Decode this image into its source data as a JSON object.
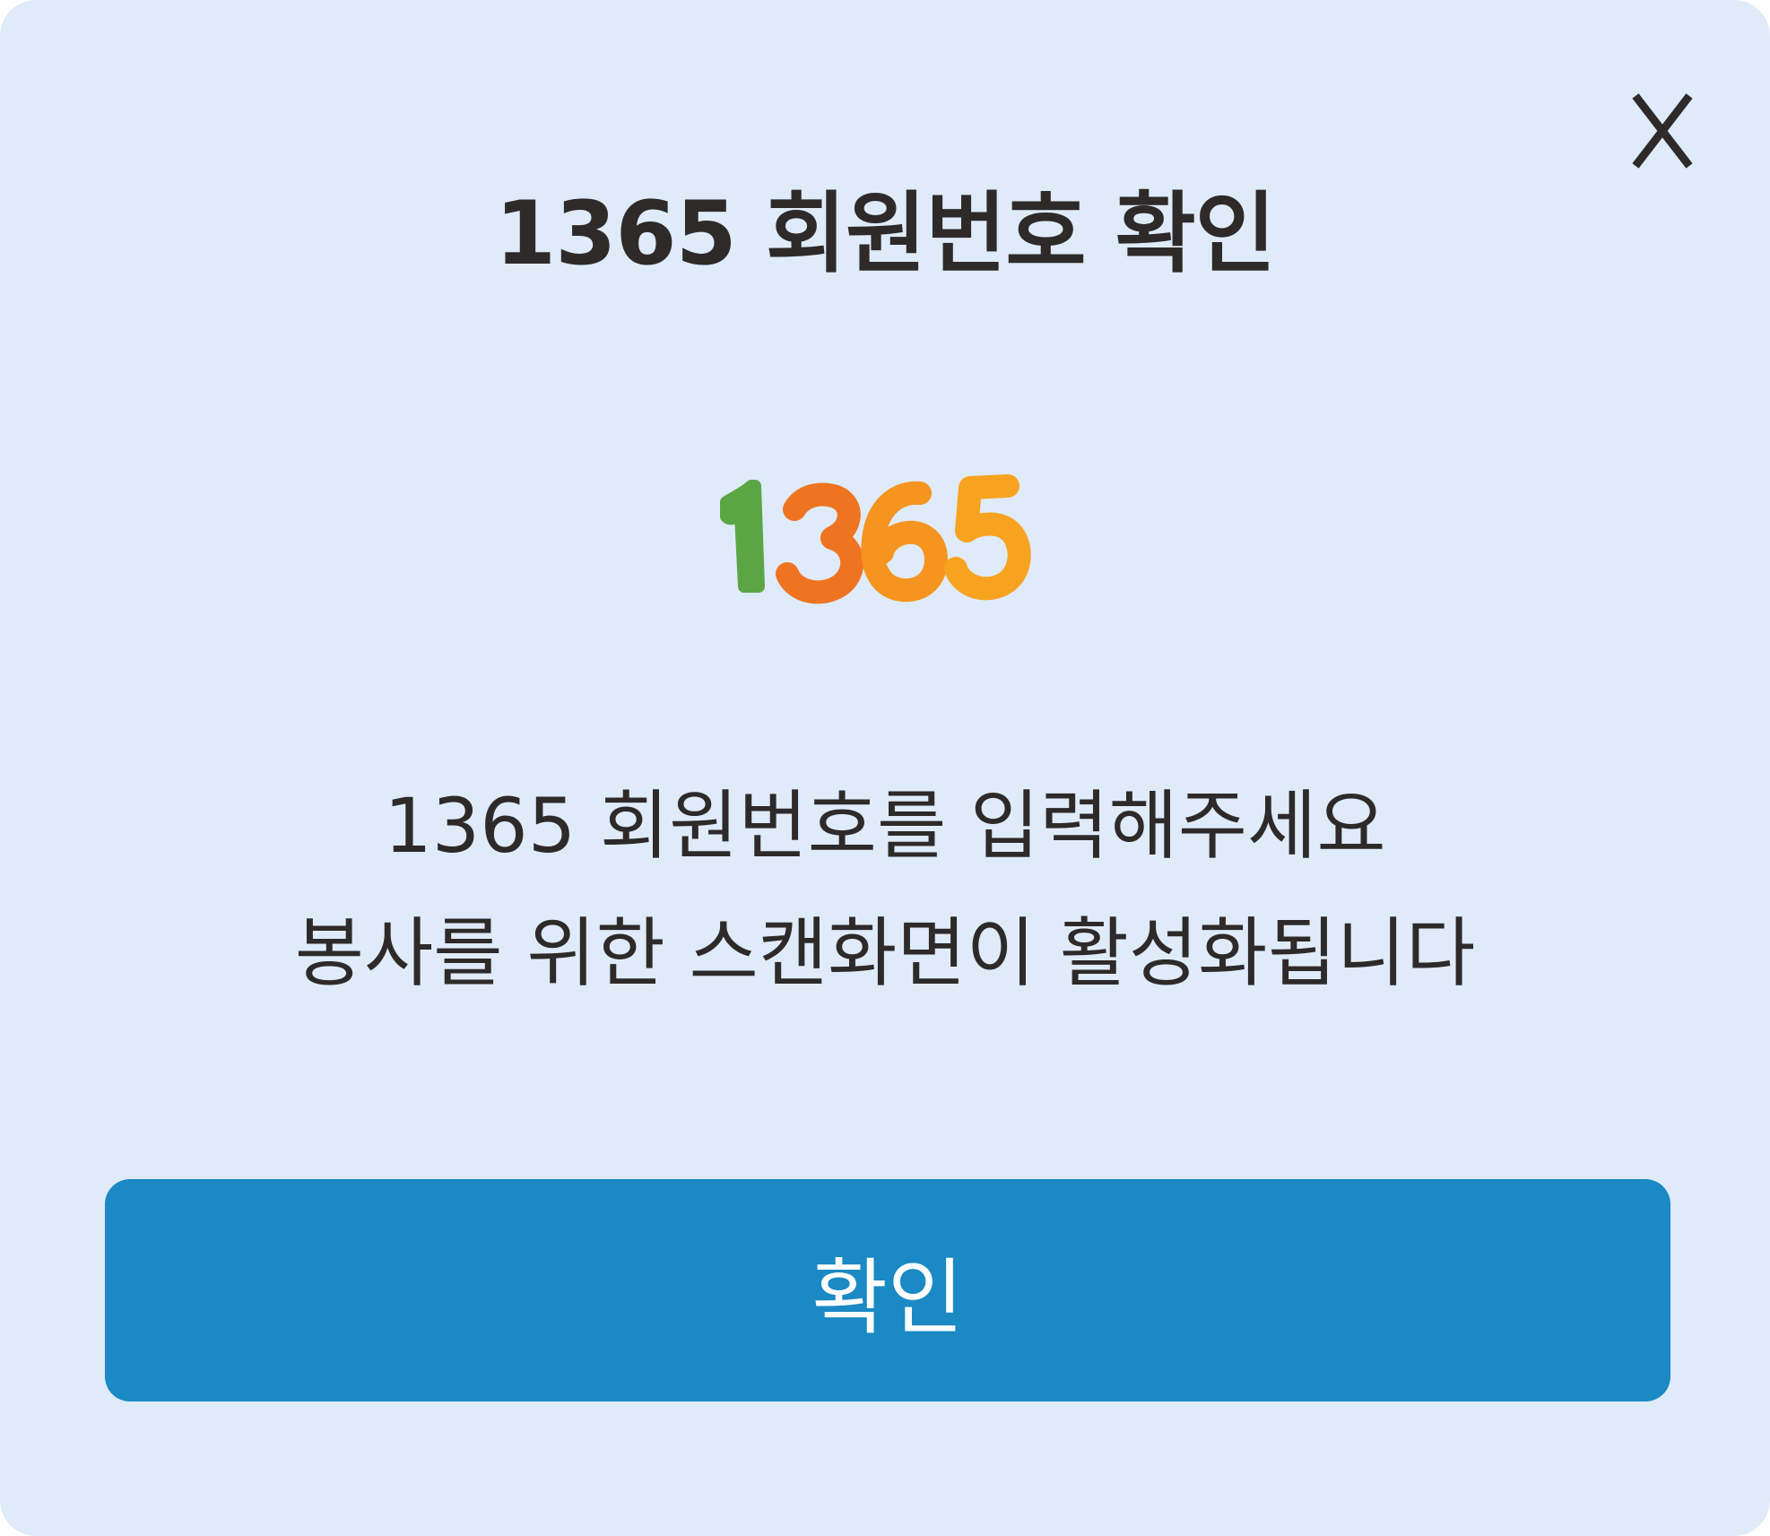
{
  "dialog": {
    "title": "1365 회원번호 확인",
    "close_label": "X",
    "logo": {
      "text": "1365",
      "colors": {
        "digit1": "#5ca545",
        "digit2": "#ef7422",
        "digit3": "#f5941e",
        "digit4": "#f8a320"
      }
    },
    "message_line1": "1365 회원번호를 입력해주세요",
    "message_line2": "봉사를 위한 스캔화면이 활성화됩니다",
    "confirm_label": "확인",
    "colors": {
      "background": "#dfebf9",
      "text": "#2e2a2a",
      "button": "#1a89c4",
      "button_text": "#ffffff"
    }
  }
}
